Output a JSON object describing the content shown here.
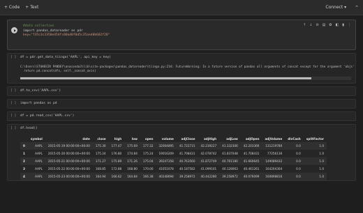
{
  "topbar": {
    "code_btn": "+ Code",
    "text_btn": "+ Text",
    "connect": "Connect",
    "connect_caret": "▾"
  },
  "cells": {
    "c1": {
      "line1": "#data collection",
      "line2": "import pandas_datareader as pdr",
      "line3": "key=\"f35c3c3350e454fc80ad0f0d5c35aed0b682f20\""
    },
    "c2": {
      "bracket": "[ ]",
      "code": "df = pdr.get_data_tiingo('AAPL', api_key = key)",
      "output1": "C:\\Users\\STUHEEIR PANDEY\\anaconda3\\lib\\site-packages\\pandas_datareader\\tiingo.py:234: FutureWarning: In a future version of pandas all arguments of concat except for the argument 'objs'",
      "output2": "  return pd.concat(dfs, self._concat_axis)"
    },
    "c3": {
      "bracket": "[ ]",
      "code": "df.to_csv('AAPL.csv')"
    },
    "c4": {
      "bracket": "[ ]",
      "code": "import pandas as pd"
    },
    "c5": {
      "bracket": "[ ]",
      "code": "df = pd.read_csv('AAPL.csv')"
    },
    "c6": {
      "bracket": "[ ]",
      "code": "df.head()"
    }
  },
  "table": {
    "columns": [
      "",
      "symbol",
      "date",
      "close",
      "high",
      "low",
      "open",
      "volume",
      "adjClose",
      "adjHigh",
      "adjLow",
      "adjOpen",
      "adjVolume",
      "divCash",
      "splitFactor"
    ],
    "rows": [
      [
        "0",
        "AAPL",
        "2015-05-19 00:00:00+00:00",
        "175.30",
        "177.47",
        "175.69",
        "177.32",
        "32004895",
        "41.722731",
        "42.239227",
        "41.332306",
        "42.203366",
        "131219780",
        "0.0",
        "1.0"
      ],
      [
        "1",
        "AAPL",
        "2015-05-20 00:00:00+00:00",
        "175.24",
        "176.80",
        "174.84",
        "175.24",
        "19016209",
        "41.708431",
        "42.078742",
        "41.837048",
        "41.708431",
        "77256136",
        "0.0",
        "1.0"
      ],
      [
        "2",
        "AAPL",
        "2015-05-21 00:00:00+00:00",
        "171.27",
        "175.89",
        "171.26",
        "175.04",
        "39247358",
        "40.763560",
        "41.872749",
        "40.761180",
        "41.660645",
        "149089432",
        "0.0",
        "1.0"
      ],
      [
        "3",
        "AAPL",
        "2015-05-22 00:00:00+00:00",
        "168.85",
        "172.88",
        "168.80",
        "170.00",
        "41051078",
        "40.187582",
        "41.099101",
        "40.128063",
        "40.461261",
        "164204304",
        "0.0",
        "1.0"
      ],
      [
        "4",
        "AAPL",
        "2015-05-23 00:00:00+00:00",
        "164.94",
        "166.62",
        "164.84",
        "166.38",
        "40248694",
        "39.258972",
        "40.442280",
        "39.258972",
        "40.076099",
        "160898816",
        "0.0",
        "1.0"
      ]
    ]
  }
}
